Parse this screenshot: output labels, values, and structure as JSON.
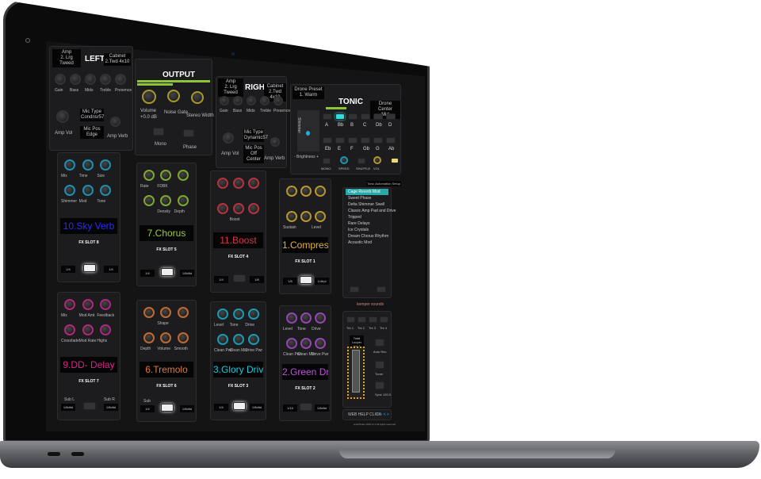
{
  "left_amp": {
    "amp_label": "Amp",
    "amp_value": "2. Lrg Tweed",
    "title": "LEFT",
    "cab_label": "Cabinet",
    "cab_value": "2.Twd 4x10",
    "knobs": [
      "Gain",
      "Bass",
      "Mids",
      "Treble",
      "Presence"
    ],
    "amp_vol": "Amp Vol",
    "mic_type_label": "Mic Type",
    "mic_type": "Condnsr57",
    "mic_pos_label": "Mic Pos",
    "mic_pos": "Edge",
    "amp_verb": "Amp Verb"
  },
  "output": {
    "title": "OUTPUT",
    "volume": "Volume",
    "volume_value": "+0.0 dB",
    "noise_gate": "Noise Gate",
    "stereo_width": "Stereo Width",
    "mono": "Mono",
    "phase": "Phase"
  },
  "right_amp": {
    "amp_label": "Amp",
    "amp_value": "2. Lrg Tweed",
    "title": "RIGHT",
    "cab_label": "Cabinet",
    "cab_value": "2.Twd 4x10",
    "knobs": [
      "Gain",
      "Bass",
      "Mids",
      "Treble",
      "Presence"
    ],
    "amp_vol": "Amp Vol",
    "mic_type_label": "Mic Type",
    "mic_type": "Dynamic57",
    "mic_pos_label": "Mic Pos",
    "mic_pos": "Off Center",
    "amp_verb": "Amp Verb"
  },
  "tonic": {
    "title": "TONIC",
    "preset_label": "Drone Preset",
    "preset_value": "1. Warm",
    "center_label": "Drone Center",
    "center_value": "Mid",
    "xy_label": "Shimmer",
    "brightness": "- Brightness +",
    "notes_row1": [
      "A",
      "Bb",
      "B",
      "C",
      "Db",
      "D"
    ],
    "notes_row2": [
      "Eb",
      "E",
      "F",
      "Gb",
      "G",
      "Ab"
    ],
    "active_note": "Bb",
    "bottom": [
      "MONO",
      "SPEED",
      "SHUFFLE",
      "VOL"
    ]
  },
  "fx_slots": [
    {
      "name": "10.Sky Verb",
      "slot": "FX SLOT 8",
      "color": "#2b2bff",
      "knob_color": "#1f8fb0",
      "knobs": [
        "Mix",
        "Time",
        "Size",
        "Shimmer",
        "Mod",
        "Tone"
      ],
      "left": "1/4",
      "right": "1/4",
      "lit": true
    },
    {
      "name": "7.Chorus",
      "slot": "FX SLOT 5",
      "color": "#9ccc3a",
      "knob_color": "#7fa832",
      "knobs": [
        "Rate",
        "FDBK",
        "",
        "",
        "Density",
        "Depth"
      ],
      "left": "1/4",
      "right": "1/8dttd",
      "lit": true
    },
    {
      "name": "11.Boost",
      "slot": "FX SLOT 4",
      "color": "#e0304a",
      "knob_color": "#b8323e",
      "knobs": [
        "",
        "",
        "",
        "",
        "Boost",
        ""
      ],
      "left": "1/4",
      "right": "1/8",
      "lit": false
    },
    {
      "name": "1.Compressor",
      "slot": "FX SLOT 1",
      "color": "#e2b13c",
      "knob_color": "#b8962e",
      "knobs": [
        "",
        "",
        "",
        "Sustain",
        "",
        "Level"
      ],
      "left": "1/8",
      "right": "1/4trpl",
      "lit": true
    },
    {
      "name": "9.DD- Delay",
      "slot": "FX SLOT 7",
      "color": "#e0208a",
      "knob_color": "#b0287a",
      "knobs": [
        "Mix",
        "Mod Amt",
        "Feedback",
        "Crossfade",
        "Mod Rate",
        "Highs"
      ],
      "left": "1/8dttd",
      "right": "1/8dttd",
      "sub_l": "Sub L",
      "sub_r": "Sub R",
      "lit": false
    },
    {
      "name": "6.Tremolo",
      "slot": "FX SLOT 6",
      "color": "#e07a3a",
      "knob_color": "#c06a30",
      "knobs": [
        "",
        "Shape",
        "",
        "Depth",
        "Volume",
        "Smooth"
      ],
      "left": "1/4",
      "right": "1/8dttd",
      "sub_l": "Sub",
      "lit": true
    },
    {
      "name": "3.Glory Drive",
      "slot": "FX SLOT 3",
      "color": "#1ec8e0",
      "knob_color": "#1a9ab0",
      "knobs": [
        "Level",
        "Tone",
        "Drive",
        "Clean Pwr",
        "Clean Mix",
        "Drive Pwr"
      ],
      "left": "1/4",
      "right": "1/8dttd",
      "lit": true
    },
    {
      "name": "2.Green Drive",
      "slot": "FX SLOT 2",
      "color": "#c050e0",
      "knob_color": "#9048b0",
      "knobs": [
        "Level",
        "Tone",
        "Drive",
        "Clean Pwr",
        "Clean Mix",
        "Drive Pwr"
      ],
      "left": "1/16",
      "right": "1/8dttd",
      "lit": false
    }
  ],
  "presets": {
    "header": "Tonic Automation Setup",
    "items": [
      "Cage Reverb Mod",
      "Sweet Phase",
      "Delta Shimmer Swell",
      "Classic Amp Pad and Drive",
      "Tripped",
      "Rare Delays",
      "Ice Crystals",
      "Dream Chorus Rhythm",
      "Acoustic Mod"
    ],
    "selected": 0
  },
  "logo": "kemper sounds",
  "looper": {
    "tracks": [
      "Trk 1",
      "Trk 2",
      "Trk 3",
      "Trk 4"
    ],
    "label": "Total Looper Vol 1",
    "auto": "Auto Rec",
    "tuner": "Tuner",
    "sync": "Sync 120.0"
  },
  "footer": {
    "status": "WEB HELP CLICK",
    "status_accent": "< > < >",
    "version": "AmpliTube 2019 v1.1 All rights reserved"
  }
}
